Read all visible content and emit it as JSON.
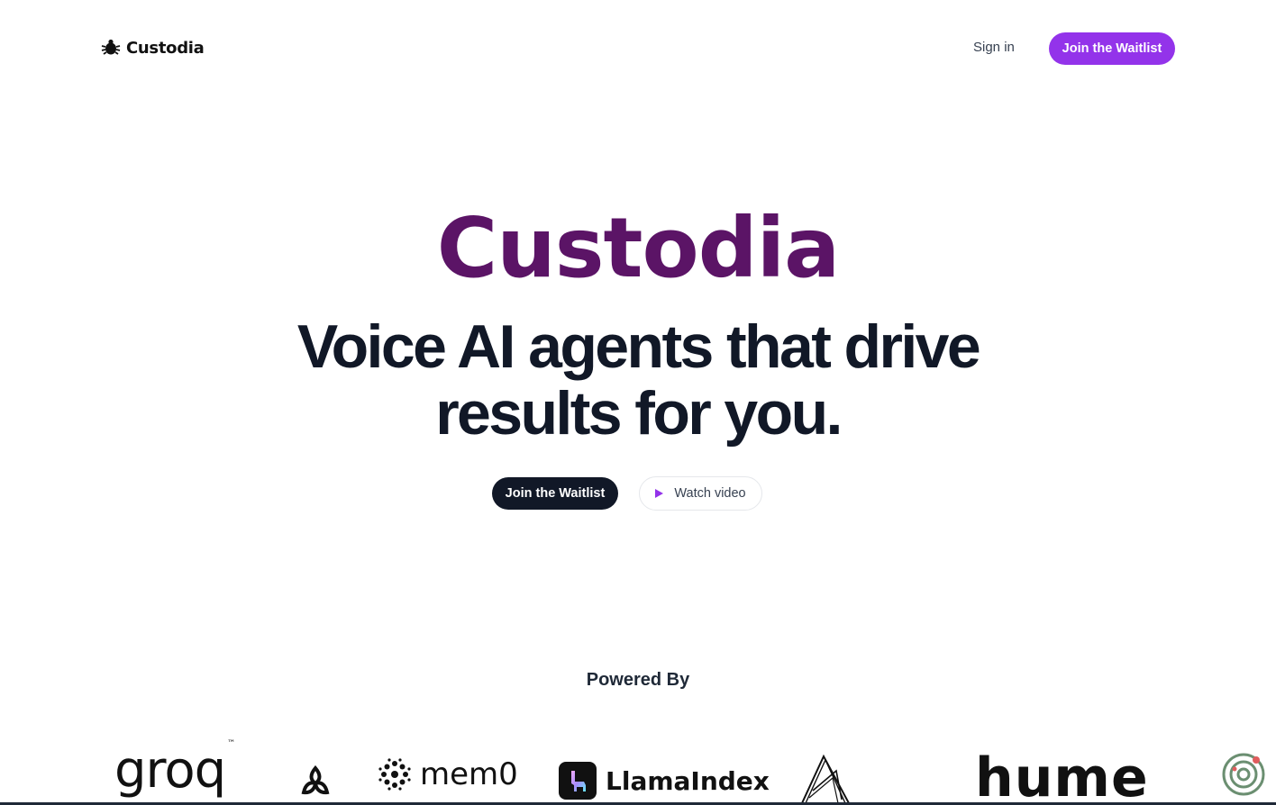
{
  "header": {
    "brand": "Custodia",
    "brand_icon": "bug-icon",
    "sign_in": "Sign in",
    "join_waitlist": "Join the Waitlist"
  },
  "hero": {
    "brand": "Custodia",
    "title_line1": "Voice AI agents that drive",
    "title_line2": "results for you.",
    "cta_primary": "Join the Waitlist",
    "cta_secondary": "Watch video",
    "cta_secondary_icon": "play-icon"
  },
  "powered_by": {
    "heading": "Powered By",
    "logos": [
      {
        "name": "groq",
        "text": "groq",
        "mark": "™"
      },
      {
        "name": "triangle-knot",
        "icon": "triangle-knot-icon"
      },
      {
        "name": "mem0",
        "text": "mem0"
      },
      {
        "name": "llamaindex",
        "text": "LlamaIndex"
      },
      {
        "name": "sketch-mark",
        "icon": "sketch-a-icon"
      },
      {
        "name": "hume",
        "text": "hume"
      },
      {
        "name": "orbit",
        "icon": "orbit-icon"
      }
    ]
  },
  "colors": {
    "accent": "#9333ea",
    "brand": "#5b1466",
    "dark": "#111827"
  }
}
